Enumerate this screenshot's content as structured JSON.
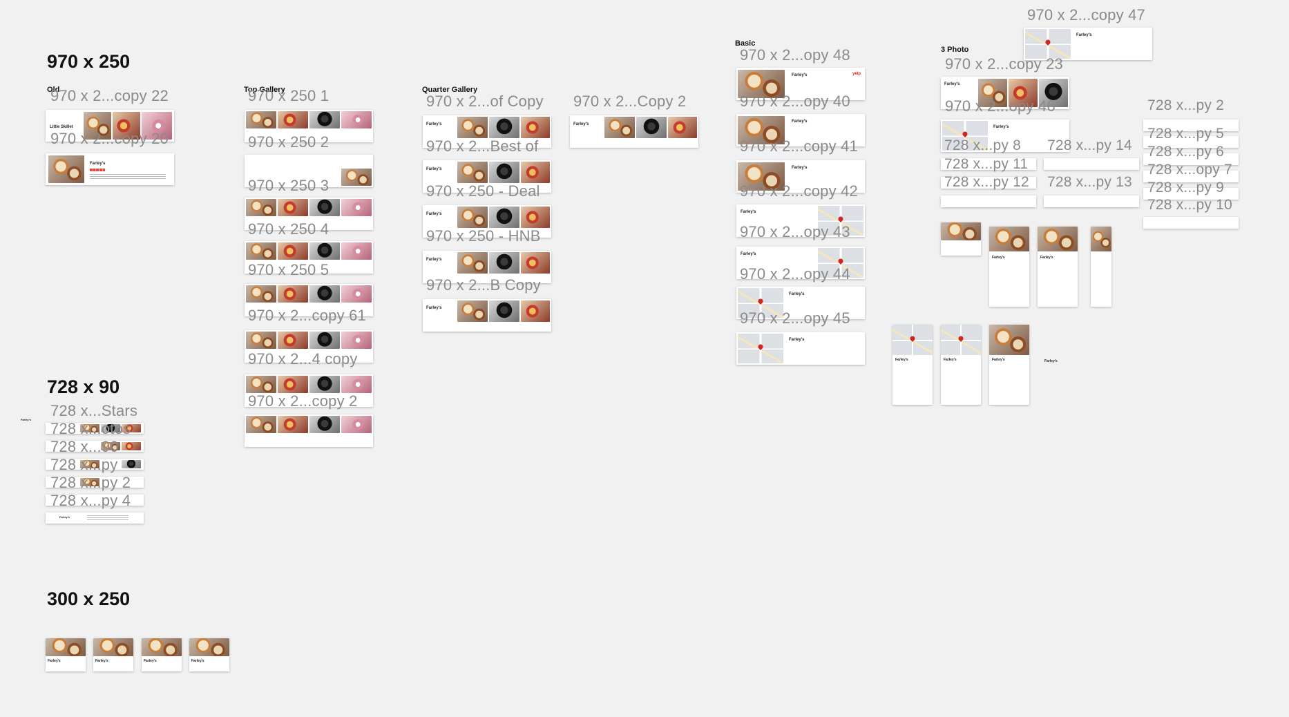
{
  "canvas": {
    "background_color": "#f1f1f1",
    "accent_color": "#d32323",
    "star_color": "#e9433b"
  },
  "sections": {
    "s970": "970 x 250",
    "s728": "728 x 90",
    "s300": "300 x 250"
  },
  "groups": {
    "old": "Old",
    "top_gallery": "Top Gallery",
    "quarter_gallery": "Quarter Gallery",
    "basic": "Basic",
    "three_photo": "3 Photo"
  },
  "ad": {
    "business": "Farley's",
    "business_alt": "Little Skillet",
    "logo": "yelp"
  },
  "artboards": {
    "a_copy22": "970 x 2...copy 22",
    "a_copy20": "970 x 2...copy 20",
    "a_tg1": "970 x 250 1",
    "a_tg2": "970 x 250 2",
    "a_tg3": "970 x 250 3",
    "a_tg4": "970 x 250 4",
    "a_tg5": "970 x 250 5",
    "a_copy61": "970 x 2...copy 61",
    "a_4copy": "970 x 2...4 copy",
    "a_copy2": "970 x 2...copy 2",
    "a_ofcopy": "970 x 2...of Copy",
    "a_bestof": "970 x 2...Best of",
    "a_deal": "970 x 250 - Deal",
    "a_hnb": "970 x 250 - HNB",
    "a_bcopy": "970 x 2...B Copy",
    "a_Copy2": "970 x 2...Copy 2",
    "a_opy48": "970 x 2...opy 48",
    "a_opy40": "970 x 2...opy 40",
    "a_copy41": "970 x 2...copy 41",
    "a_copy42": "970 x 2...copy 42",
    "a_opy43": "970 x 2...opy 43",
    "a_opy44": "970 x 2...opy 44",
    "a_opy45": "970 x 2...opy 45",
    "a_copy47": "970 x 2...copy 47",
    "a_copy23": "970 x 2...copy 23",
    "a_opy46": "970 x 2...opy 46",
    "b_stars": "728 x...Stars",
    "b_1": "728 x...otos",
    "b_2": "728 x...90",
    "b_3": "728 x...py",
    "b_4": "728 x...py 2",
    "b_5": "728 x...py 4",
    "b_py8": "728 x...py 8",
    "b_py14": "728 x...py 14",
    "b_py11": "728 x...py 11",
    "b_py12": "728 x...py 12",
    "b_py13": "728 x...py 13",
    "b_py2r": "728 x...py 2",
    "b_py5": "728 x...py 5",
    "b_py6": "728 x...py 6",
    "b_opy7": "728 x...opy 7",
    "b_py9": "728 x...py 9",
    "b_py10": "728 x...py 10"
  }
}
